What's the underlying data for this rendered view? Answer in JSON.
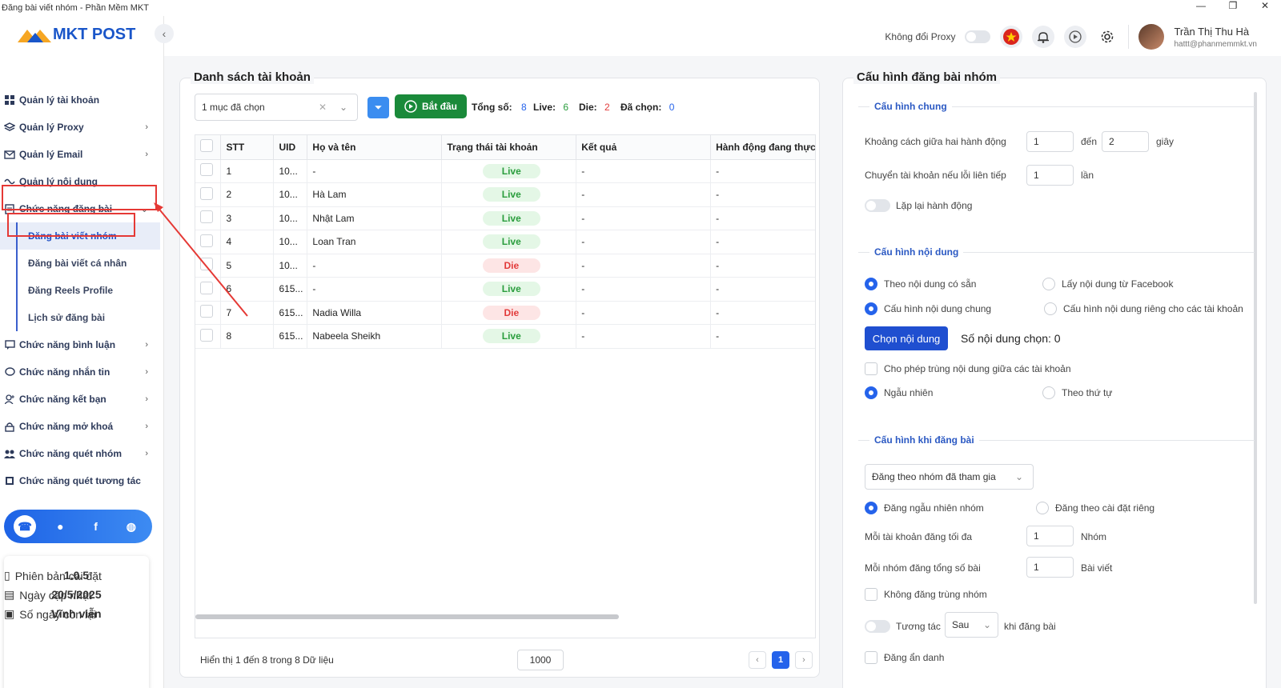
{
  "window": {
    "title": "Đăng bài viết nhóm - Phần Mềm MKT",
    "controls": [
      "—",
      "❐",
      "✕"
    ]
  },
  "brand": {
    "logo_text": "MKT POST"
  },
  "header": {
    "proxy_label": "Không đổi Proxy",
    "user_name": "Trần Thị Thu Hà",
    "user_email": "hattt@phanmemmkt.vn"
  },
  "sidebar": {
    "items": [
      {
        "label": "Quản lý tài khoản",
        "icon": "grid-icon",
        "chevron": false
      },
      {
        "label": "Quản lý Proxy",
        "icon": "layers-icon",
        "chevron": true
      },
      {
        "label": "Quản lý Email",
        "icon": "email-icon",
        "chevron": true
      },
      {
        "label": "Quản lý nội dung",
        "icon": "content-icon",
        "chevron": false
      },
      {
        "label": "Chức năng đăng bài",
        "icon": "post-icon",
        "chevron": true
      }
    ],
    "subitems": [
      {
        "label": "Đăng bài viết nhóm"
      },
      {
        "label": "Đăng bài viết cá nhân"
      },
      {
        "label": "Đăng Reels Profile"
      },
      {
        "label": "Lịch sử đăng bài"
      }
    ],
    "items2": [
      {
        "label": "Chức năng bình luận",
        "icon": "comment-icon"
      },
      {
        "label": "Chức năng nhắn tin",
        "icon": "message-icon"
      },
      {
        "label": "Chức năng kết bạn",
        "icon": "add-friend-icon"
      },
      {
        "label": "Chức năng mở khoá",
        "icon": "lock-icon"
      },
      {
        "label": "Chức năng quét nhóm",
        "icon": "group-icon"
      },
      {
        "label": "Chức năng quét tương tác",
        "icon": "scan-icon"
      }
    ],
    "version": {
      "version_label": "Phiên bản cài đặt",
      "version_value": "1.0.5",
      "update_label": "Ngày cập nhật",
      "update_value": "20/5/2025",
      "days_label": "Số ngày còn lại",
      "days_value": "Vĩnh viễn"
    }
  },
  "accounts": {
    "title": "Danh sách tài khoản",
    "select_value": "1 mục đã chọn",
    "start_label": "Bắt đầu",
    "total_label": "Tổng số:",
    "total": "8",
    "live_label": "Live:",
    "live": "6",
    "die_label": "Die:",
    "die": "2",
    "selected_label": "Đã chọn:",
    "selected": "0",
    "columns": [
      "STT",
      "UID",
      "Họ và tên",
      "Trạng thái tài khoản",
      "Kết quả",
      "Hành động đang thực h"
    ],
    "rows": [
      {
        "stt": "1",
        "uid": "10...",
        "name": "-",
        "status": "Live",
        "result": "-",
        "action": "-"
      },
      {
        "stt": "2",
        "uid": "10...",
        "name": "Hà Lam",
        "status": "Live",
        "result": "-",
        "action": "-"
      },
      {
        "stt": "3",
        "uid": "10...",
        "name": "Nhật Lam",
        "status": "Live",
        "result": "-",
        "action": "-"
      },
      {
        "stt": "4",
        "uid": "10...",
        "name": "Loan Tran",
        "status": "Live",
        "result": "-",
        "action": "-"
      },
      {
        "stt": "5",
        "uid": "10...",
        "name": "-",
        "status": "Die",
        "result": "-",
        "action": "-"
      },
      {
        "stt": "6",
        "uid": "615...",
        "name": "-",
        "status": "Live",
        "result": "-",
        "action": "-"
      },
      {
        "stt": "7",
        "uid": "615...",
        "name": "Nadia Willa",
        "status": "Die",
        "result": "-",
        "action": "-"
      },
      {
        "stt": "8",
        "uid": "615...",
        "name": "Nabeela Sheikh",
        "status": "Live",
        "result": "-",
        "action": "-"
      }
    ],
    "footer_text": "Hiển thị 1 đến 8 trong 8 Dữ liệu",
    "page_size": "1000",
    "current_page": "1"
  },
  "config": {
    "title": "Cấu hình đăng bài nhóm",
    "general": {
      "heading": "Cấu hình chung",
      "interval_label": "Khoảng cách giữa hai hành động",
      "interval_from": "1",
      "to_label": "đến",
      "interval_to": "2",
      "unit_seconds": "giây",
      "switch_label": "Chuyển tài khoản nếu lỗi liên tiếp",
      "switch_value": "1",
      "unit_times": "lần",
      "repeat_label": "Lặp lại hành động"
    },
    "content": {
      "heading": "Cấu hình nội dung",
      "opt_available": "Theo nội dung có sẵn",
      "opt_facebook": "Lấy nội dung từ Facebook",
      "opt_common": "Cấu hình nội dung chung",
      "opt_private": "Cấu hình nội dung riêng cho các tài khoản",
      "choose_button": "Chọn nội dung",
      "count_label": "Số nội dung chọn: 0",
      "allow_duplicate": "Cho phép trùng nội dung giữa các tài khoản",
      "opt_random": "Ngẫu nhiên",
      "opt_order": "Theo thứ tự"
    },
    "posting": {
      "heading": "Cấu hình khi đăng bài",
      "group_select": "Đăng theo nhóm đã tham gia",
      "opt_random_group": "Đăng ngẫu nhiên nhóm",
      "opt_custom": "Đăng theo cài đặt riêng",
      "max_groups_label": "Mỗi tài khoản đăng tối đa",
      "max_groups": "1",
      "unit_group": "Nhóm",
      "posts_per_group_label": "Mỗi nhóm đăng tổng số bài",
      "posts_per_group": "1",
      "unit_post": "Bài viết",
      "no_duplicate_group": "Không đăng trùng nhóm",
      "interact_label": "Tương tác",
      "interact_select": "Sau",
      "interact_suffix": "khi đăng bài",
      "anonymous": "Đăng ẩn danh"
    }
  }
}
